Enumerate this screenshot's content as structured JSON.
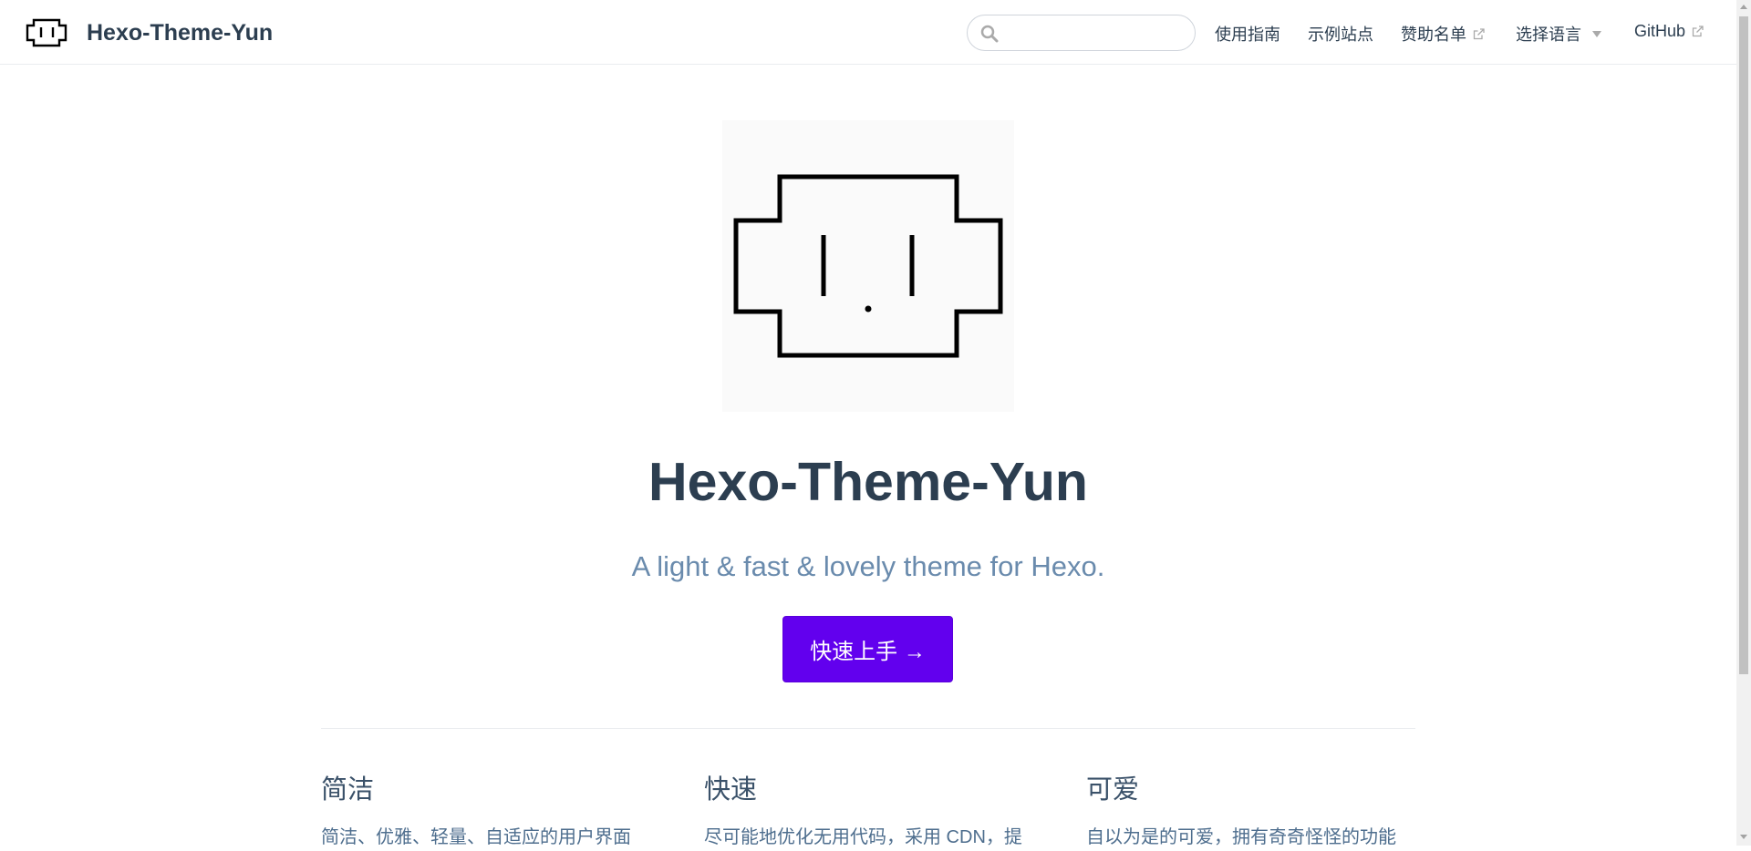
{
  "navbar": {
    "title": "Hexo-Theme-Yun",
    "search": {
      "value": "",
      "placeholder": ""
    },
    "links": [
      {
        "label": "使用指南",
        "external": false
      },
      {
        "label": "示例站点",
        "external": false
      },
      {
        "label": "赞助名单",
        "external": true
      },
      {
        "label": "选择语言",
        "dropdown": true
      },
      {
        "label": "GitHub",
        "external": true
      }
    ]
  },
  "hero": {
    "image_icon": "yun-cloud-face-logo",
    "title": "Hexo-Theme-Yun",
    "description": "A light & fast & lovely theme for Hexo.",
    "action_label": "快速上手 →",
    "action_color": "#6200ee"
  },
  "features": [
    {
      "title": "简洁",
      "details": "简洁、优雅、轻量、自适应的用户界面"
    },
    {
      "title": "快速",
      "details": "尽可能地优化无用代码，采用 CDN，提"
    },
    {
      "title": "可爱",
      "details": "自以为是的可爱，拥有奇奇怪怪的功能"
    }
  ],
  "colors": {
    "text": "#2c3e50",
    "description": "#6a8bad",
    "accent": "#6200ee"
  }
}
